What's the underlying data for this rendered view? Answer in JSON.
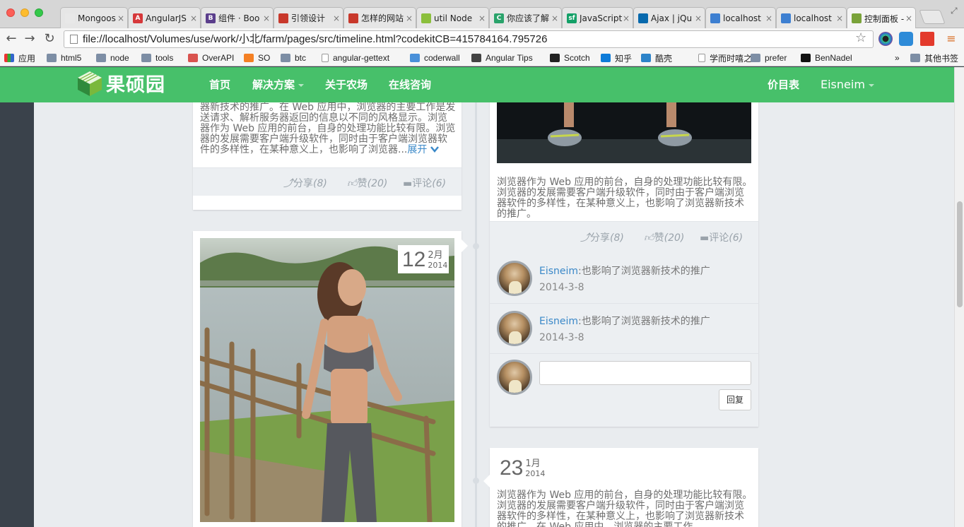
{
  "browser": {
    "tabs": [
      {
        "label": "Mongoos",
        "fav_color": "#e8e8e8",
        "fav_text": ""
      },
      {
        "label": "AngularJS",
        "fav_color": "#d6383a",
        "fav_text": "A"
      },
      {
        "label": "组件 · Boo",
        "fav_color": "#5b3e8c",
        "fav_text": "B"
      },
      {
        "label": "引领设计",
        "fav_color": "#c8382b",
        "fav_text": ""
      },
      {
        "label": "怎样的网站",
        "fav_color": "#c8382b",
        "fav_text": ""
      },
      {
        "label": "util Node",
        "fav_color": "#8bbf3c",
        "fav_text": ""
      },
      {
        "label": "你应该了解",
        "fav_color": "#2aa36b",
        "fav_text": "C"
      },
      {
        "label": "JavaScript",
        "fav_color": "#13a067",
        "fav_text": "sf"
      },
      {
        "label": "Ajax | jQu",
        "fav_color": "#0769ad",
        "fav_text": ""
      },
      {
        "label": "localhost",
        "fav_color": "#3d7fd1",
        "fav_text": ""
      },
      {
        "label": "localhost",
        "fav_color": "#3d7fd1",
        "fav_text": ""
      },
      {
        "label": "控制面板 -",
        "fav_color": "#7aa33a",
        "fav_text": ""
      }
    ],
    "url": "file://localhost/Volumes/use/work/小北/farm/pages/src/timeline.html?codekitCB=415784164.795726",
    "bookmarks": [
      {
        "label": "应用",
        "type": "apps"
      },
      {
        "label": "html5",
        "type": "folder"
      },
      {
        "label": "node",
        "type": "folder"
      },
      {
        "label": "tools",
        "type": "folder"
      },
      {
        "label": "OverAPI",
        "type": "site",
        "color": "#d9534f"
      },
      {
        "label": "SO",
        "type": "site",
        "color": "#f48024"
      },
      {
        "label": "btc",
        "type": "folder"
      },
      {
        "label": "angular-gettext",
        "type": "page"
      },
      {
        "label": "coderwall",
        "type": "site",
        "color": "#4a90d9"
      },
      {
        "label": "Angular Tips",
        "type": "site",
        "color": "#444"
      },
      {
        "label": "Scotch",
        "type": "site",
        "color": "#222"
      },
      {
        "label": "知乎",
        "type": "site",
        "color": "#0e7bd8"
      },
      {
        "label": "酷壳",
        "type": "site",
        "color": "#2c83c9"
      },
      {
        "label": "学而时嘻之",
        "type": "page"
      },
      {
        "label": "prefer",
        "type": "folder"
      },
      {
        "label": "BenNadel",
        "type": "site",
        "color": "#111"
      }
    ],
    "bookmarks_more": "»",
    "other_bookmarks": "其他书签"
  },
  "site": {
    "logo_text": "果硕园",
    "brand_color": "#47c06a",
    "nav": [
      {
        "label": "首页",
        "dropdown": false
      },
      {
        "label": "解决方案",
        "dropdown": true
      },
      {
        "label": "关于农场",
        "dropdown": false
      },
      {
        "label": "在线咨询",
        "dropdown": false
      }
    ],
    "right_nav": [
      {
        "label": "价目表",
        "dropdown": false
      },
      {
        "label": "Eisneim",
        "dropdown": true
      }
    ]
  },
  "timeline": {
    "left_card_1": {
      "text": "器新技术的推广。在 Web 应用中，浏览器的主要工作是发送请求、解析服务器返回的信息以不同的风格显示。浏览器作为 Web 应用的前台，自身的处理功能比较有限。浏览器的发展需要客户端升级软件，同时由于客户端浏览器软件的多样性，在某种意义上，也影响了浏览器...",
      "more": "展开",
      "share": "分享",
      "share_count": "(8)",
      "like": "赞",
      "like_count": "(20)",
      "comment": "评论",
      "comment_count": "(6)"
    },
    "left_card_2": {
      "date_day": "12",
      "date_month": "2月",
      "date_year": "2014"
    },
    "right_card_1": {
      "text": "浏览器作为 Web 应用的前台，自身的处理功能比较有限。浏览器的发展需要客户端升级软件，同时由于客户端浏览器软件的多样性，在某种意义上，也影响了浏览器新技术的推广。",
      "share": "分享",
      "share_count": "(8)",
      "like": "赞",
      "like_count": "(20)",
      "comment": "评论",
      "comment_count": "(6)",
      "comments": [
        {
          "author": "Eisneim",
          "text": ":也影响了浏览器新技术的推广",
          "date": "2014-3-8"
        },
        {
          "author": "Eisneim",
          "text": ":也影响了浏览器新技术的推广",
          "date": "2014-3-8"
        }
      ],
      "reply_label": "回复"
    },
    "right_card_2": {
      "date_day": "23",
      "date_month": "1月",
      "date_year": "2014",
      "text": "浏览器作为 Web 应用的前台，自身的处理功能比较有限。浏览器的发展需要客户端升级软件，同时由于客户端浏览器软件的多样性，在某种意义上，也影响了浏览器新技术的推广。在 Web 应用中，浏览器的主要工作"
    }
  }
}
